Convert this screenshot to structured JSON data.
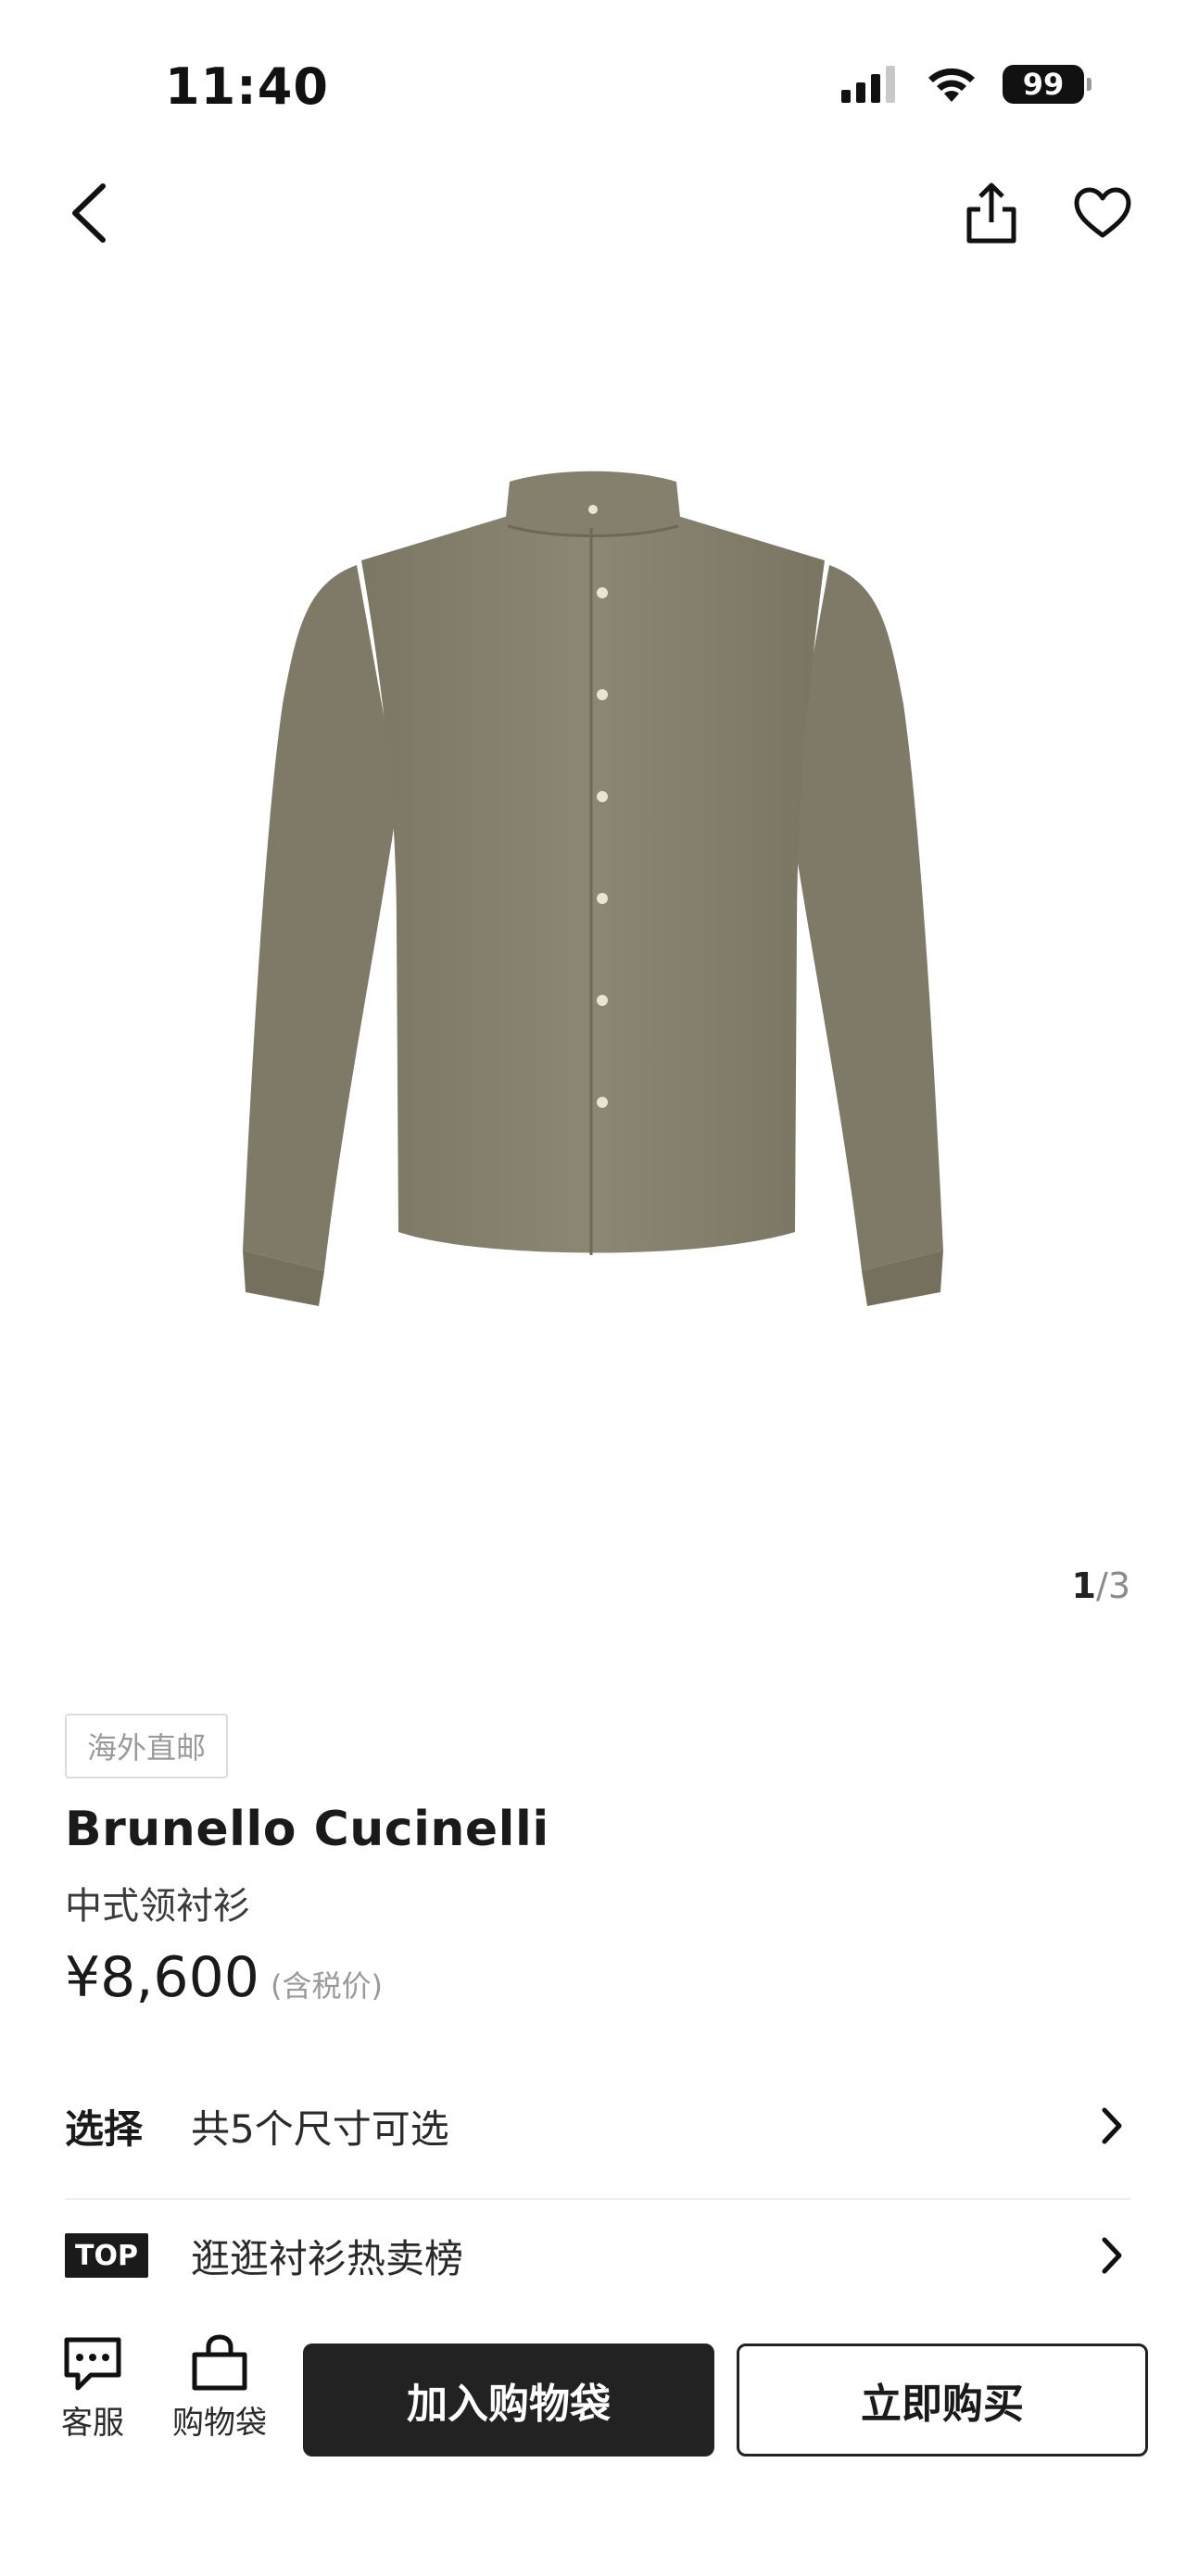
{
  "status_bar": {
    "time": "11:40",
    "battery": "99"
  },
  "nav": {
    "back_icon": "chevron-left-icon",
    "share_icon": "share-icon",
    "favorite_icon": "heart-icon"
  },
  "gallery": {
    "current": "1",
    "separator": "/",
    "total": "3",
    "shirt_color": "#8a8472"
  },
  "product": {
    "tag": "海外直邮",
    "brand": "Brunello Cucinelli",
    "name": "中式领衬衫",
    "price": "¥8,600",
    "tax_note": "(含税价)"
  },
  "options": [
    {
      "label": "选择",
      "text": "共5个尺寸可选"
    },
    {
      "badge": "TOP",
      "text": "逛逛衬衫热卖榜"
    }
  ],
  "bottom_bar": {
    "customer_service": "客服",
    "bag": "购物袋",
    "add_to_bag": "加入购物袋",
    "buy_now": "立即购买"
  }
}
